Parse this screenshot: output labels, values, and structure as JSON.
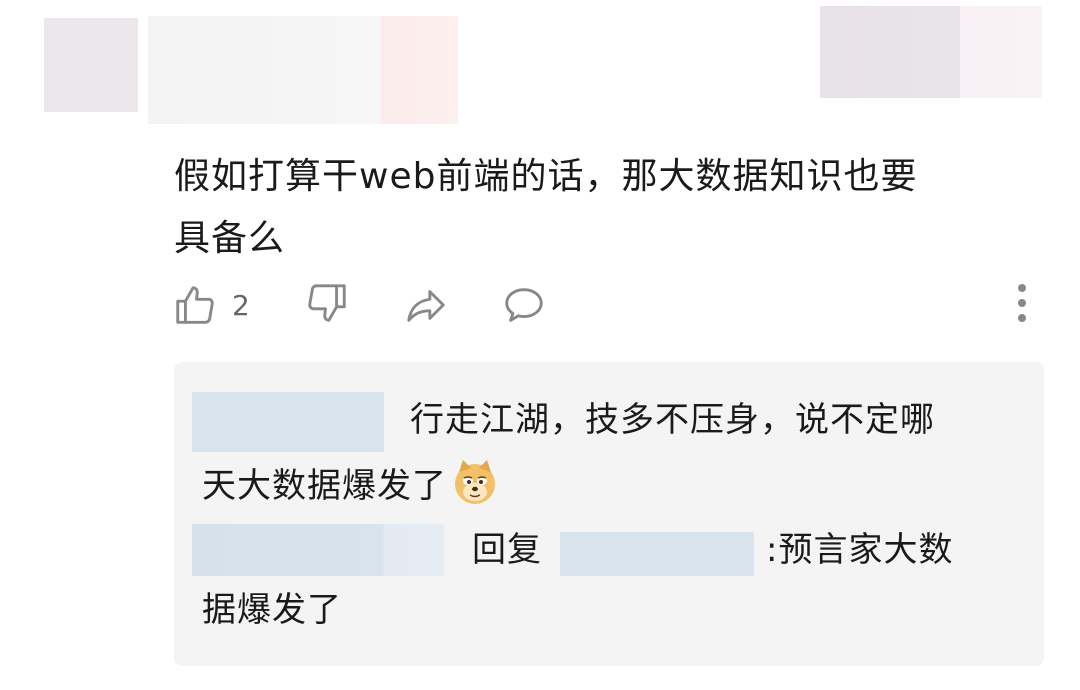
{
  "comment": {
    "text": "假如打算干web前端的话，那大数据知识也要具备么",
    "line1": "假如打算干web前端的话，那大数据知识也要",
    "line2": "具备么"
  },
  "actions": {
    "like_count": "2",
    "icons": [
      "thumbs-up-icon",
      "thumbs-down-icon",
      "share-icon",
      "comment-icon",
      "more-vertical-icon"
    ]
  },
  "replies": [
    {
      "text_line1": "行走江湖，技多不压身，说不定哪",
      "text_line2": "天大数据爆发了",
      "emoji": "doge-emoji"
    },
    {
      "reply_word": "回复",
      "text_line1": ":预言家大数",
      "text_line2": "据爆发了"
    }
  ],
  "colors": {
    "reply_bg": "#f4f4f4",
    "username_blur": "#d8e3ee",
    "icon": "#888888"
  }
}
